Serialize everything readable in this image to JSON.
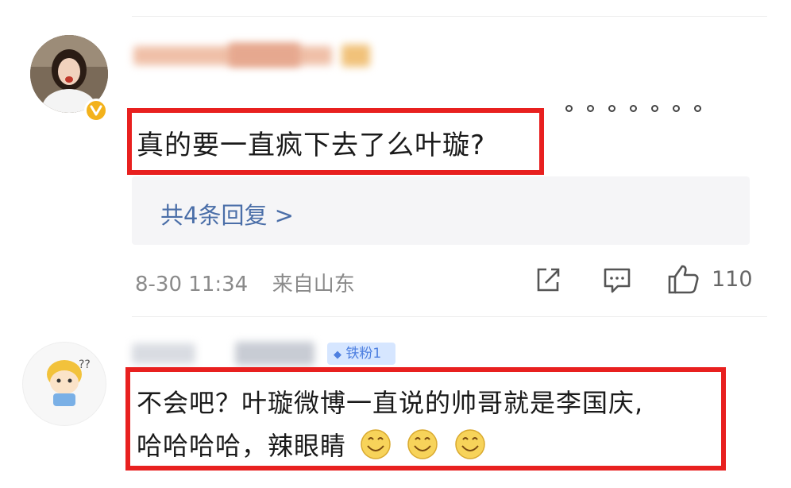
{
  "comment1": {
    "text": "真的要一直疯下去了么叶璇?",
    "replies_label": "共4条回复 >",
    "date": "8-30 11:34",
    "location": "来自山东",
    "like_count": "110"
  },
  "comment2": {
    "badge": "铁粉1",
    "line1": "不会吧？叶璇微博一直说的帅哥就是李国庆,",
    "line2": "哈哈哈哈，辣眼睛"
  },
  "icons": {
    "share": "share-icon",
    "comment": "comment-icon",
    "like": "thumbs-up-icon",
    "more": "more-dots-icon",
    "verified": "verified-v-icon",
    "emoji": "smile-emoji-icon"
  },
  "colors": {
    "highlight_box": "#e8201f",
    "link": "#4a6ea8",
    "verified": "#f3b21b",
    "fan_badge": "#d6e6ff"
  }
}
